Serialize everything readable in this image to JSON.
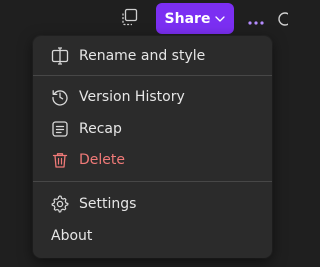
{
  "toolbar": {
    "share_label": "Share"
  },
  "menu": {
    "items": [
      {
        "label": "Rename and style",
        "icon": "rename-style-icon"
      },
      {
        "label": "Version History",
        "icon": "history-icon"
      },
      {
        "label": "Recap",
        "icon": "recap-icon"
      },
      {
        "label": "Delete",
        "icon": "trash-icon"
      },
      {
        "label": "Settings",
        "icon": "gear-icon"
      },
      {
        "label": "About"
      }
    ]
  },
  "colors": {
    "background": "#1f1f1f",
    "menu_bg": "#2b2b2b",
    "share_button": "#7b2ff2",
    "more_dots": "#b58cff",
    "danger": "#f07a78",
    "text": "#e6e6e6"
  }
}
